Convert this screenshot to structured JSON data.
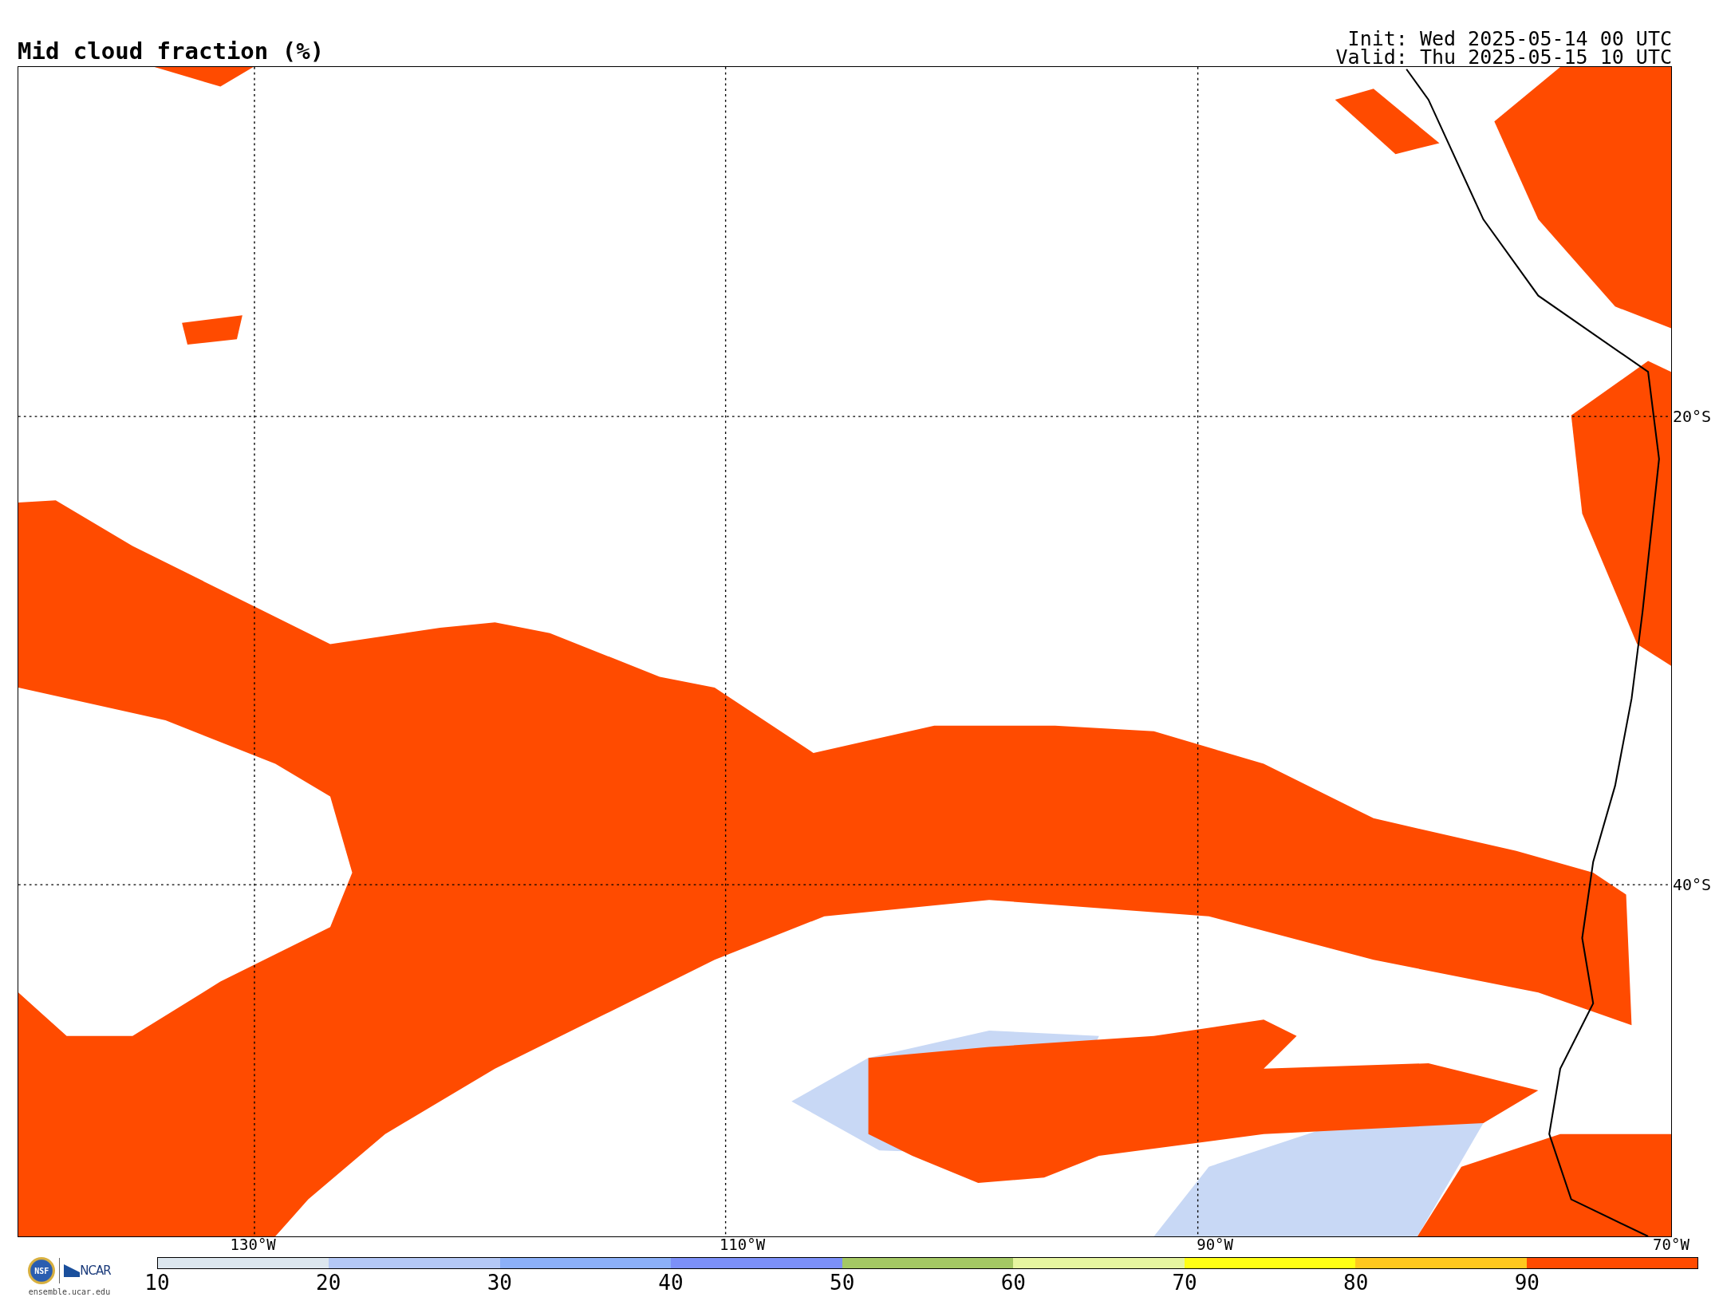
{
  "title": "Mid cloud fraction (%)",
  "init": "Init: Wed 2025-05-14 00 UTC",
  "valid": "Valid: Thu 2025-05-15 10 UTC",
  "map": {
    "lon_labels": [
      "130°W",
      "110°W",
      "90°W",
      "70°W"
    ],
    "lat_labels": [
      "20°S",
      "40°S"
    ]
  },
  "logos": {
    "nsf": "NSF",
    "ncar": "NCAR",
    "site": "ensemble.ucar.edu"
  },
  "colorbar": {
    "bins": [
      {
        "label": "10",
        "color": "#dce6ee"
      },
      {
        "label": "20",
        "color": "#b4c8f5"
      },
      {
        "label": "30",
        "color": "#8cb0f8"
      },
      {
        "label": "40",
        "color": "#7c90f8"
      },
      {
        "label": "50",
        "color": "#a4c864"
      },
      {
        "label": "60",
        "color": "#e6f5a0"
      },
      {
        "label": "70",
        "color": "#ffff14"
      },
      {
        "label": "80",
        "color": "#ffc81e"
      },
      {
        "label": "90",
        "color": "#ff4b00"
      }
    ]
  }
}
